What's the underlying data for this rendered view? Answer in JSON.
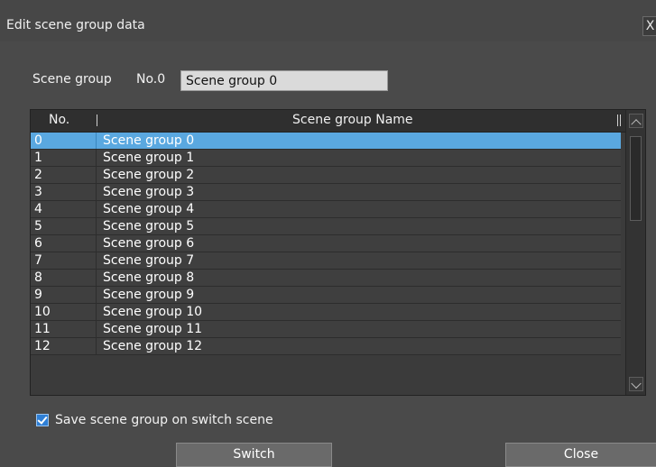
{
  "dialog": {
    "title": "Edit scene group data",
    "close_glyph": "X"
  },
  "scene_group": {
    "label": "Scene group",
    "number": "No.0",
    "name_value": "Scene group 0"
  },
  "table": {
    "columns": [
      "No.",
      "Scene group Name"
    ],
    "selected_index": 0,
    "rows": [
      {
        "no": "0",
        "name": "Scene group 0"
      },
      {
        "no": "1",
        "name": "Scene group 1"
      },
      {
        "no": "2",
        "name": "Scene group 2"
      },
      {
        "no": "3",
        "name": "Scene group 3"
      },
      {
        "no": "4",
        "name": "Scene group 4"
      },
      {
        "no": "5",
        "name": "Scene group 5"
      },
      {
        "no": "6",
        "name": "Scene group 6"
      },
      {
        "no": "7",
        "name": "Scene group 7"
      },
      {
        "no": "8",
        "name": "Scene group 8"
      },
      {
        "no": "9",
        "name": "Scene group 9"
      },
      {
        "no": "10",
        "name": "Scene group 10"
      },
      {
        "no": "11",
        "name": "Scene group 11"
      },
      {
        "no": "12",
        "name": "Scene group 12"
      }
    ]
  },
  "save_option": {
    "label": "Save scene group on switch scene",
    "checked": true
  },
  "buttons": {
    "switch": "Switch",
    "close": "Close"
  },
  "icons": {
    "scroll_up": "chevron-up-icon",
    "scroll_down": "chevron-down-icon",
    "check": "checkmark-icon"
  },
  "colors": {
    "selection": "#5aa8e0",
    "checkbox": "#2e7fd6",
    "background": "#4a4a4a"
  }
}
